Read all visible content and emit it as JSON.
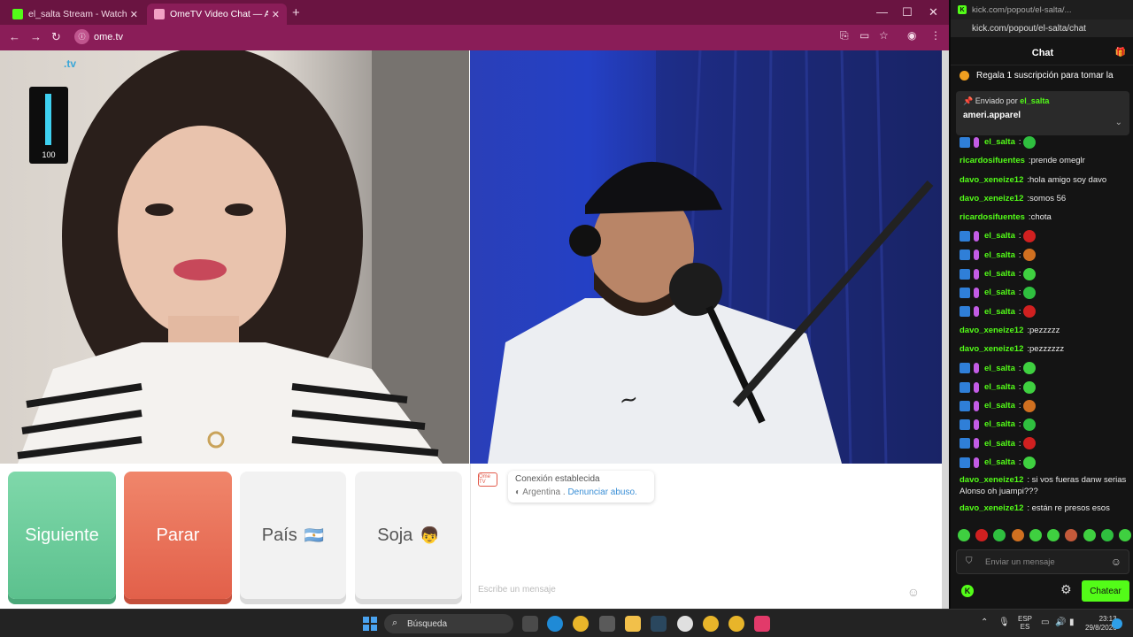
{
  "browser": {
    "tabs": [
      {
        "title": "el_salta Stream - Watch Live on",
        "active": false
      },
      {
        "title": "OmeTV Video Chat — Alter",
        "active": true
      }
    ],
    "url": "ome.tv"
  },
  "ome": {
    "logo_text": ".tv",
    "mic_level": 100,
    "mic_level_label": "100",
    "buttons": {
      "next": "Siguiente",
      "stop": "Parar",
      "country": "País",
      "gender": "Soja",
      "country_emoji": "🇦🇷",
      "gender_emoji": "👦"
    },
    "notice": {
      "badge": "Ome TV",
      "title": "Conexión establecida",
      "country": "Argentina .",
      "report_link": "Denunciar abuso."
    },
    "chat_placeholder": "Escribe un mensaje"
  },
  "kick": {
    "window_title": "kick.com/popout/el-salta/...",
    "url": "kick.com/popout/el-salta/chat",
    "header": "Chat",
    "sub_banner": "Regala 1 suscripción para tomar la",
    "pinned": {
      "sent_by_label": "Enviado por",
      "sent_by_user": "el_salta",
      "message": "ameri.apparel"
    },
    "messages": [
      {
        "user": "el_salta",
        "color": "#53fc18",
        "badges": true,
        "text": "",
        "emotes": [
          "#2fbf3f"
        ]
      },
      {
        "user": "ricardosifuentes",
        "color": "#53fc18",
        "badges": false,
        "text": "prende omeglr",
        "emotes": []
      },
      {
        "user": "davo_xeneize12",
        "color": "#53fc18",
        "badges": false,
        "text": "hola amigo soy davo",
        "emotes": []
      },
      {
        "user": "davo_xeneize12",
        "color": "#53fc18",
        "badges": false,
        "text": "somos 56",
        "emotes": []
      },
      {
        "user": "ricardosifuentes",
        "color": "#53fc18",
        "badges": false,
        "text": "chota",
        "emotes": []
      },
      {
        "user": "el_salta",
        "color": "#53fc18",
        "badges": true,
        "text": "",
        "emotes": [
          "#d02020"
        ]
      },
      {
        "user": "el_salta",
        "color": "#53fc18",
        "badges": true,
        "text": "",
        "emotes": [
          "#d07020"
        ]
      },
      {
        "user": "el_salta",
        "color": "#53fc18",
        "badges": true,
        "text": "",
        "emotes": [
          "#3fd040"
        ]
      },
      {
        "user": "el_salta",
        "color": "#53fc18",
        "badges": true,
        "text": "",
        "emotes": [
          "#2fbf3f"
        ]
      },
      {
        "user": "el_salta",
        "color": "#53fc18",
        "badges": true,
        "text": "",
        "emotes": [
          "#d02020"
        ]
      },
      {
        "user": "davo_xeneize12",
        "color": "#53fc18",
        "badges": false,
        "text": "pezzzzz",
        "emotes": []
      },
      {
        "user": "davo_xeneize12",
        "color": "#53fc18",
        "badges": false,
        "text": "pezzzzzz",
        "emotes": []
      },
      {
        "user": "el_salta",
        "color": "#53fc18",
        "badges": true,
        "text": "",
        "emotes": [
          "#3fd040"
        ]
      },
      {
        "user": "el_salta",
        "color": "#53fc18",
        "badges": true,
        "text": "",
        "emotes": [
          "#3fd040"
        ]
      },
      {
        "user": "el_salta",
        "color": "#53fc18",
        "badges": true,
        "text": "",
        "emotes": [
          "#d07020"
        ]
      },
      {
        "user": "el_salta",
        "color": "#53fc18",
        "badges": true,
        "text": "",
        "emotes": [
          "#2fbf3f"
        ]
      },
      {
        "user": "el_salta",
        "color": "#53fc18",
        "badges": true,
        "text": "",
        "emotes": [
          "#d02020"
        ]
      },
      {
        "user": "el_salta",
        "color": "#53fc18",
        "badges": true,
        "text": "",
        "emotes": [
          "#3fd040"
        ]
      }
    ],
    "long_messages": [
      {
        "user": "davo_xeneize12",
        "text": "si vos fueras danw serias Alonso oh juampi???"
      },
      {
        "user": "davo_xeneize12",
        "text": "están re presos esos"
      }
    ],
    "input_placeholder": "Enviar un mensaje",
    "send_label": "Chatear"
  },
  "taskbar": {
    "search": "Búsqueda",
    "lang_line1": "ESP",
    "lang_line2": "ES",
    "time": "23:13",
    "date": "29/8/2026"
  },
  "colors": {
    "tabstrip": "#6a1441",
    "toolbar": "#8a1d58",
    "kick_green": "#53fc18",
    "next_green": "#5cc18e",
    "stop_red": "#e2604a"
  }
}
